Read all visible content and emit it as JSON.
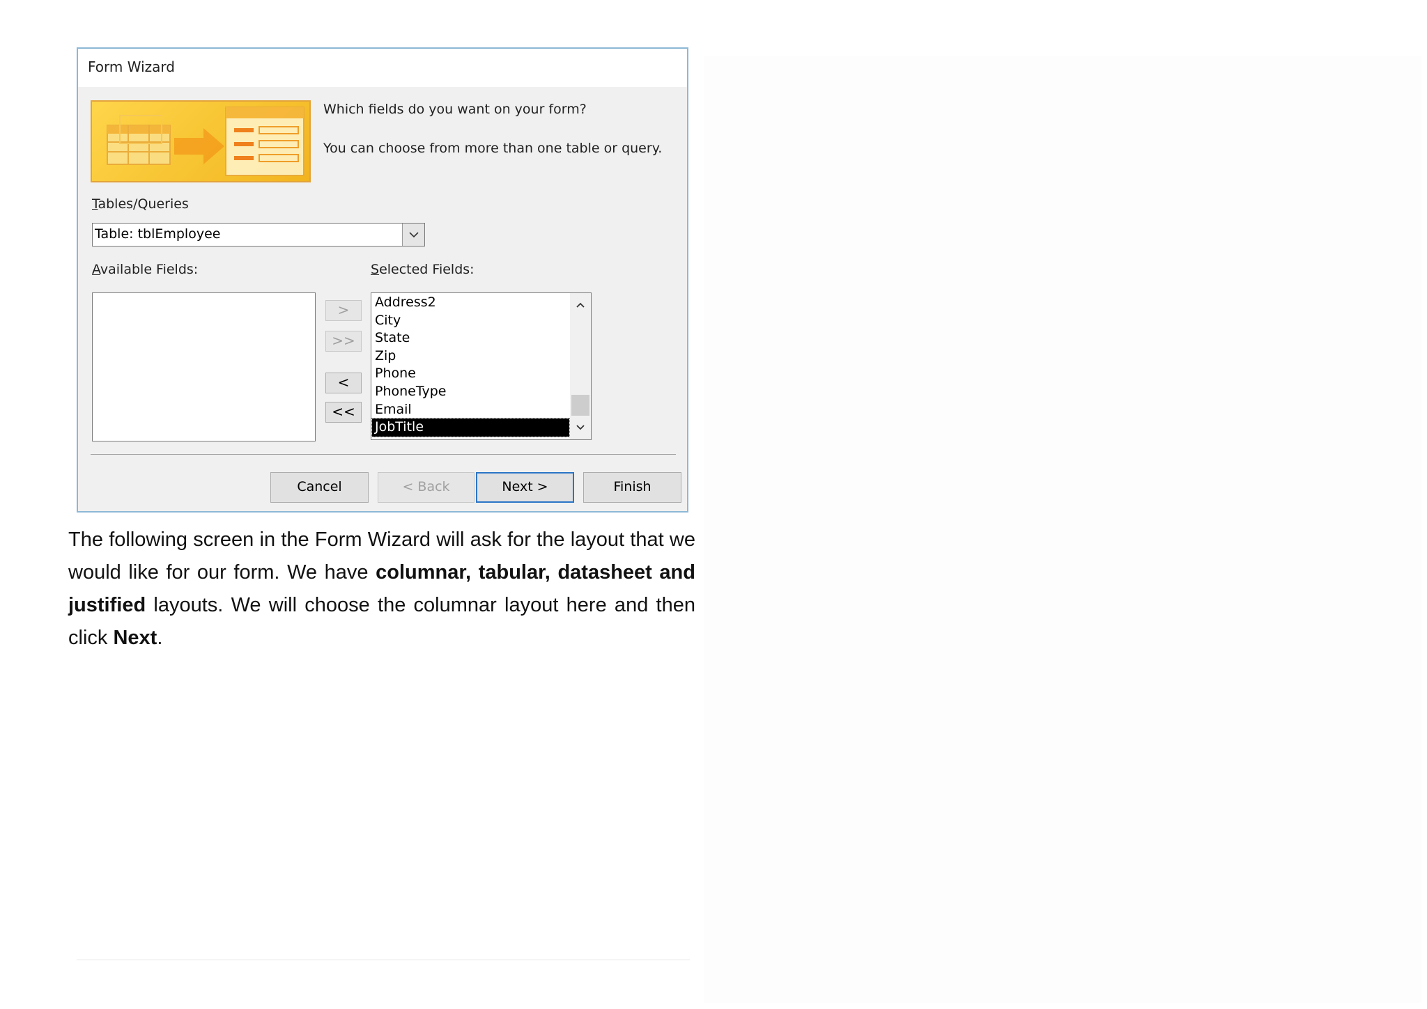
{
  "dialog": {
    "title": "Form Wizard",
    "prompt_line1": "Which fields do you want on your form?",
    "prompt_line2": "You can choose from more than one table or query.",
    "tables_label_accesskey": "T",
    "tables_label_rest": "ables/Queries",
    "combo_value": "Table: tblEmployee",
    "available_label_accesskey": "A",
    "available_label_rest": "vailable Fields:",
    "selected_label_accesskey": "S",
    "selected_label_rest": "elected Fields:",
    "selected_fields": [
      "Address2",
      "City",
      "State",
      "Zip",
      "Phone",
      "PhoneType",
      "Email",
      "JobTitle"
    ],
    "selected_field_active": "JobTitle",
    "move_buttons": {
      "add_one": ">",
      "add_all": ">>",
      "remove_one": "<",
      "remove_all": "<<"
    },
    "buttons": {
      "cancel": "Cancel",
      "back": "< Back",
      "next": "Next >",
      "finish": "Finish"
    }
  },
  "text": {
    "part1": "The following screen in the Form Wizard will ask for the layout that we would like for our form. We have ",
    "bold1": "columnar, tabular, datasheet and justified",
    "part2": " layouts. We will choose the columnar layout here and then click ",
    "bold2": "Next",
    "part3": "."
  },
  "icons": [
    "wizard-banner-icon",
    "chevron-down-icon",
    "scroll-up-icon",
    "scroll-down-icon"
  ]
}
